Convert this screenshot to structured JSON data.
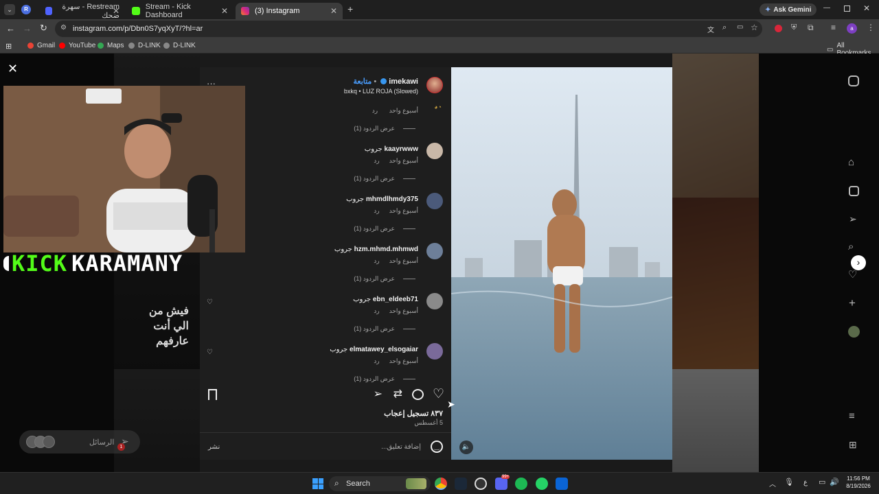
{
  "browser": {
    "tabs": [
      {
        "label": "Restream - سهرة ضحك",
        "favicon_color": "#4f63ff"
      },
      {
        "label": "Stream - Kick Dashboard",
        "favicon_color": "#53fc18"
      },
      {
        "label": "(3) Instagram",
        "favicon_color": "#e1306c"
      }
    ],
    "profile_badge": "R",
    "ask_gemini": "Ask Gemini",
    "url": "instagram.com/p/Dbn0S7yqXyT/?hl=ar",
    "bookmarks": [
      "Gmail",
      "YouTube",
      "Maps",
      "D-LINK",
      "D-LINK"
    ],
    "all_bookmarks": "All Bookmarks",
    "avatar_letter": "a"
  },
  "overlay": {
    "streamer_prefix": "KICK",
    "streamer_name": "KARAMANY",
    "dm_label": "الرسائل",
    "dm_badge": "1",
    "bg_caption_1": "فيش من",
    "bg_caption_2": "الي أنت",
    "bg_caption_3": "عارفهم"
  },
  "post": {
    "author": "imekawi",
    "follow_label": "متابعة",
    "audio": "bxkq • LUZ ROJA (Slowed)",
    "top_meta_time": "أسبوع واحد",
    "top_meta_reply": "رد",
    "top_view_replies": "عرض الردود (1)",
    "comments": [
      {
        "user": "kaayrwww",
        "text": "جروب",
        "time": "أسبوع واحد",
        "reply": "رد",
        "view_replies": "عرض الردود (1)",
        "avatar_color": "#c9b8a8"
      },
      {
        "user": "mhmdlhmdy375",
        "text": "جروب",
        "time": "أسبوع واحد",
        "reply": "رد",
        "view_replies": "عرض الردود (1)",
        "avatar_color": "#4b5a7a"
      },
      {
        "user": "hzm.mhmd.mhmwd",
        "text": "جروب",
        "time": "أسبوع واحد",
        "reply": "رد",
        "view_replies": "عرض الردود (1)",
        "avatar_color": "#6d7f99"
      },
      {
        "user": "ebn_eldeeb71",
        "text": "جروب",
        "time": "أسبوع واحد",
        "reply": "رد",
        "view_replies": "عرض الردود (1)",
        "avatar_color": "#8a8a8a"
      },
      {
        "user": "elmatawey_elsogaiar",
        "text": "جروب",
        "time": "أسبوع واحد",
        "reply": "رد",
        "view_replies": "عرض الردود (1)",
        "avatar_color": "#7a6a9a"
      }
    ],
    "likes": "٨٣٧ تسجيل إعجاب",
    "date": "5 أغسطس",
    "comment_placeholder": "إضافة تعليق...",
    "post_button": "نشر"
  },
  "taskbar": {
    "search_label": "Search",
    "time": "11:56 PM",
    "date": "8/19/2026",
    "lang": "ع",
    "badge_count": "99+"
  },
  "colors": {
    "kick_green": "#53fc18",
    "panel_bg": "#1e1e1e",
    "link_blue": "#4a9eff"
  }
}
